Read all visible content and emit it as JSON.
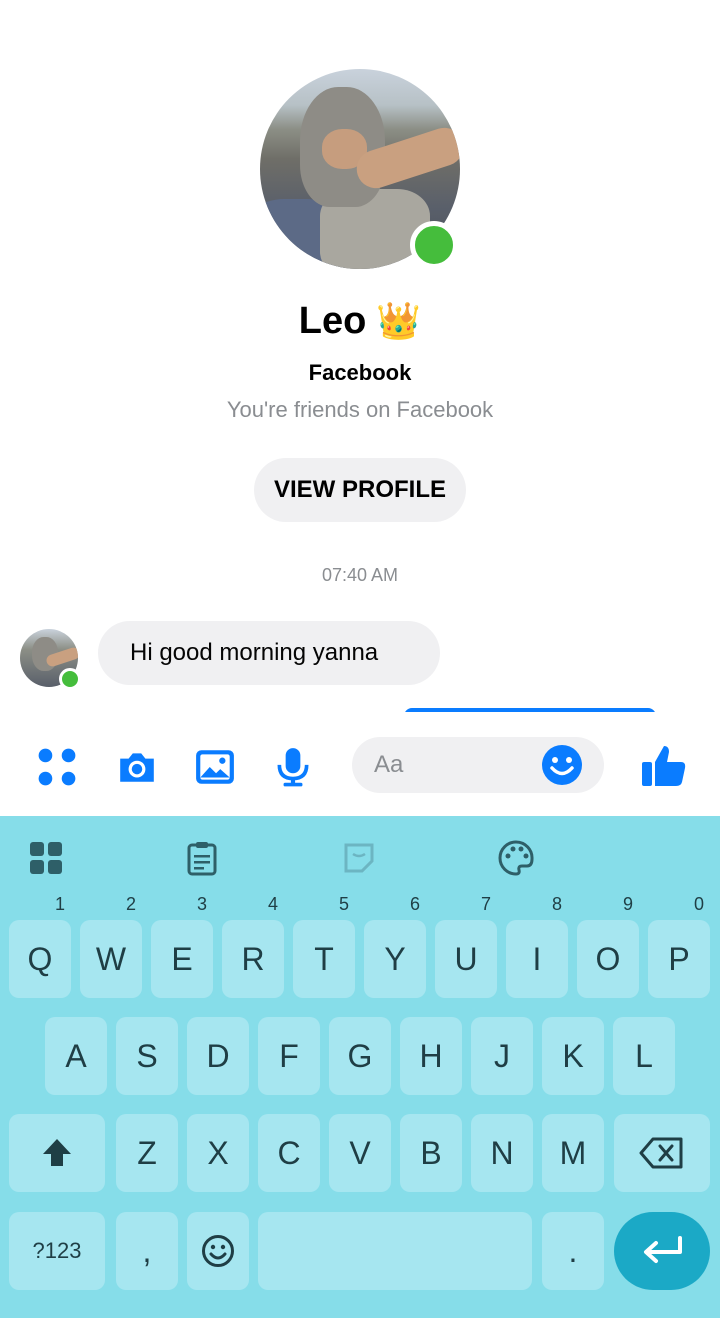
{
  "profile": {
    "name": "Leo",
    "name_emoji": "👑",
    "platform": "Facebook",
    "relationship": "You're friends on Facebook",
    "view_profile_label": "VIEW PROFILE",
    "online": true
  },
  "conversation": {
    "timestamp": "07:40 AM",
    "messages": [
      {
        "sender": "Leo",
        "text": "Hi good morning yanna"
      }
    ]
  },
  "composer": {
    "icons": [
      "apps-icon",
      "camera-icon",
      "gallery-icon",
      "microphone-icon"
    ],
    "placeholder": "Aa",
    "emoji_icon": "smiley-icon",
    "send_icon": "thumbs-up-icon",
    "accent_color": "#0a7cff"
  },
  "keyboard": {
    "toolbar": [
      "grid-icon",
      "clipboard-icon",
      "sticker-icon",
      "palette-icon"
    ],
    "row1": [
      {
        "key": "Q",
        "hint": "1"
      },
      {
        "key": "W",
        "hint": "2"
      },
      {
        "key": "E",
        "hint": "3"
      },
      {
        "key": "R",
        "hint": "4"
      },
      {
        "key": "T",
        "hint": "5"
      },
      {
        "key": "Y",
        "hint": "6"
      },
      {
        "key": "U",
        "hint": "7"
      },
      {
        "key": "I",
        "hint": "8"
      },
      {
        "key": "O",
        "hint": "9"
      },
      {
        "key": "P",
        "hint": "0"
      }
    ],
    "row2": [
      "A",
      "S",
      "D",
      "F",
      "G",
      "H",
      "J",
      "K",
      "L"
    ],
    "row3": [
      "Z",
      "X",
      "C",
      "V",
      "B",
      "N",
      "M"
    ],
    "symbols_label": "?123",
    "comma_label": ",",
    "period_label": ".",
    "background_color": "#86dde9",
    "enter_color": "#1ba9c6"
  }
}
